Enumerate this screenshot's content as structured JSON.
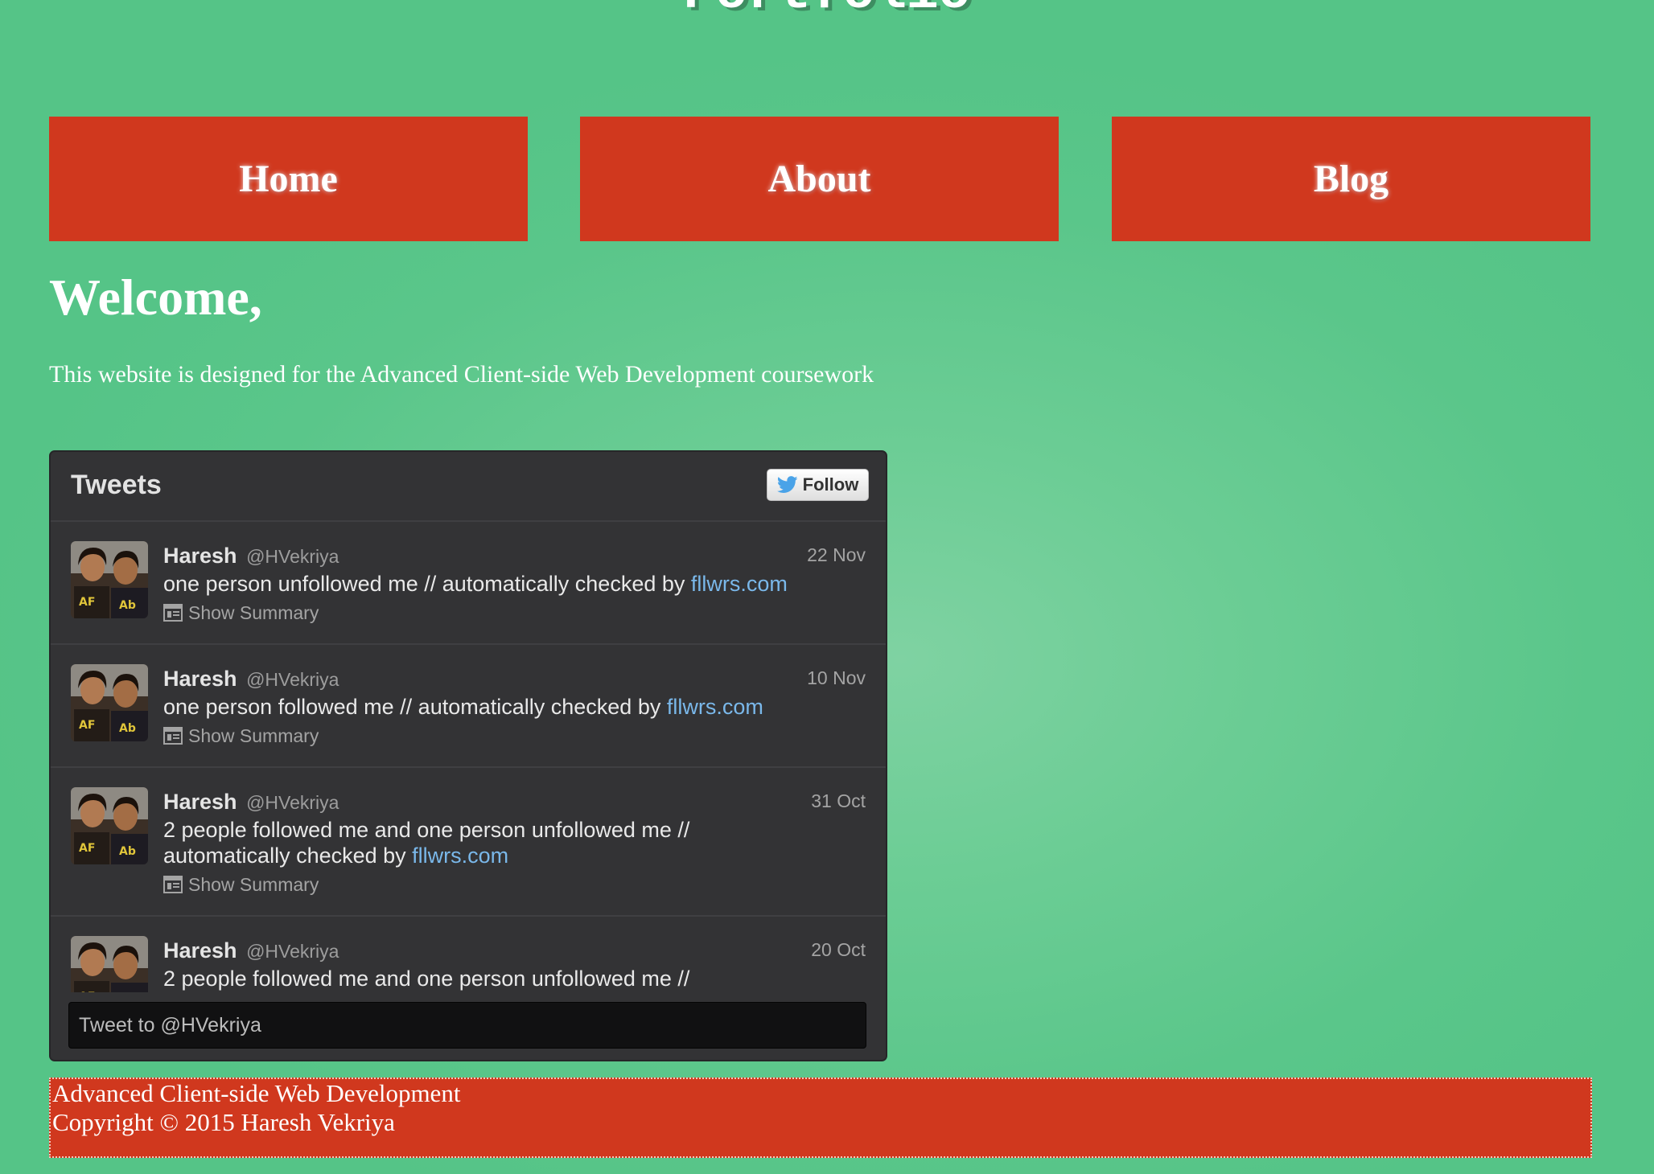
{
  "site": {
    "title": "Portfolio"
  },
  "nav": {
    "items": [
      {
        "label": "Home"
      },
      {
        "label": "About"
      },
      {
        "label": "Blog"
      }
    ]
  },
  "main": {
    "heading": "Welcome,",
    "intro": "This website is designed for the Advanced Client-side Web Development coursework"
  },
  "widget": {
    "title": "Tweets",
    "follow_label": "Follow",
    "summary_label": "Show Summary",
    "compose_placeholder": "Tweet to @HVekriya",
    "tweets": [
      {
        "name": "Haresh",
        "handle": "@HVekriya",
        "date": "22 Nov",
        "text": "one person unfollowed me // automatically checked by",
        "link": "fllwrs.com"
      },
      {
        "name": "Haresh",
        "handle": "@HVekriya",
        "date": "10 Nov",
        "text": "one person followed me // automatically checked by",
        "link": "fllwrs.com"
      },
      {
        "name": "Haresh",
        "handle": "@HVekriya",
        "date": "31 Oct",
        "text": "2 people followed me and one person unfollowed me // automatically checked by",
        "link": "fllwrs.com"
      },
      {
        "name": "Haresh",
        "handle": "@HVekriya",
        "date": "20 Oct",
        "text": "2 people followed me and one person unfollowed me //",
        "link": ""
      }
    ]
  },
  "footer": {
    "line1": "Advanced Client-side Web Development",
    "line2": "Copyright © 2015 Haresh Vekriya"
  },
  "colors": {
    "background": "#5ac68a",
    "accent_red": "#d0381e",
    "widget_bg": "#333335",
    "link": "#7ab8ea"
  },
  "icons": {
    "follow": "twitter-bird-icon",
    "summary": "summary-card-icon",
    "avatar": "avatar-photo"
  }
}
